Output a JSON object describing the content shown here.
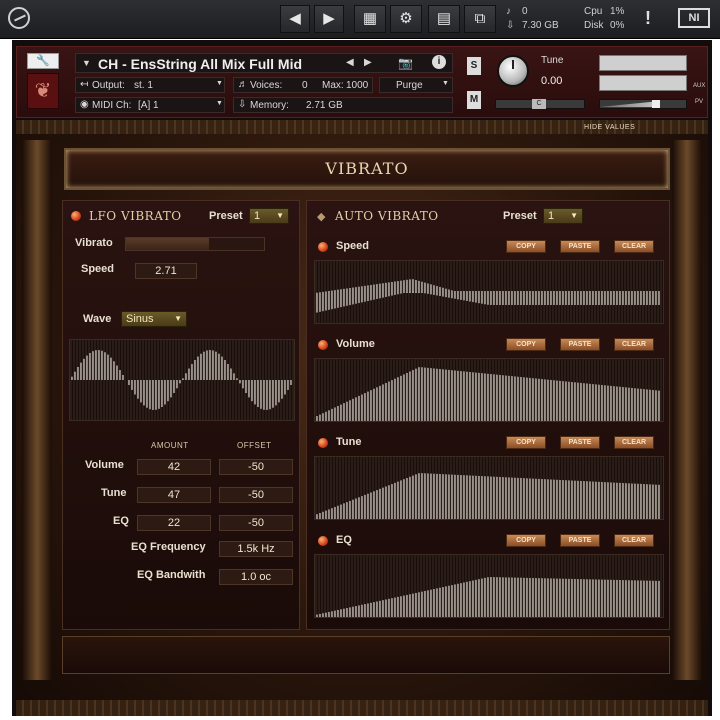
{
  "host": {
    "voices_count": "0",
    "memory": "7.30 GB",
    "cpu_label": "Cpu",
    "cpu_value": "1%",
    "disk_label": "Disk",
    "disk_value": "0%",
    "warning": "!",
    "ni_logo": "NI"
  },
  "instrument": {
    "name": "CH - EnsString All Mix Full Mid",
    "output_label": "Output:",
    "output_value": "st. 1",
    "voices_label": "Voices:",
    "voices_value": "0",
    "max_label": "Max:",
    "max_value": "1000",
    "purge_label": "Purge",
    "midi_label": "MIDI Ch:",
    "midi_value": "[A] 1",
    "memory_label": "Memory:",
    "memory_value": "2.71 GB",
    "solo_label": "S",
    "mute_label": "M",
    "tune_label": "Tune",
    "tune_value": "0.00",
    "aux_label": "AUX",
    "pv_label": "PV",
    "center_label": "C",
    "hide_values_label": "HIDE VALUES"
  },
  "vibrato": {
    "title": "VIBRATO",
    "lfo": {
      "title": "LFO VIBRATO",
      "preset_label": "Preset",
      "preset_value": "1",
      "vibrato_label": "Vibrato",
      "vibrato_level": 0.6,
      "speed_label": "Speed",
      "speed_value": "2.71",
      "wave_label": "Wave",
      "wave_value": "Sinus",
      "amount_header": "AMOUNT",
      "offset_header": "OFFSET",
      "rows": [
        {
          "label": "Volume",
          "amount": "42",
          "offset": "-50"
        },
        {
          "label": "Tune",
          "amount": "47",
          "offset": "-50"
        },
        {
          "label": "EQ",
          "amount": "22",
          "offset": "-50"
        }
      ],
      "eq_frequency_label": "EQ Frequency",
      "eq_frequency_value": "1.5k Hz",
      "eq_bandwidth_label": "EQ Bandwith",
      "eq_bandwidth_value": "1.0 oc"
    },
    "auto": {
      "title": "AUTO VIBRATO",
      "preset_label": "Preset",
      "preset_value": "1",
      "copy_label": "COPY",
      "paste_label": "PASTE",
      "clear_label": "CLEAR",
      "envelopes": [
        {
          "label": "Speed"
        },
        {
          "label": "Volume"
        },
        {
          "label": "Tune"
        },
        {
          "label": "EQ"
        }
      ]
    }
  },
  "colors": {
    "accent_led": "#d0401a",
    "button_copper": "#c88a55",
    "text_cream": "#e8e0d0"
  }
}
